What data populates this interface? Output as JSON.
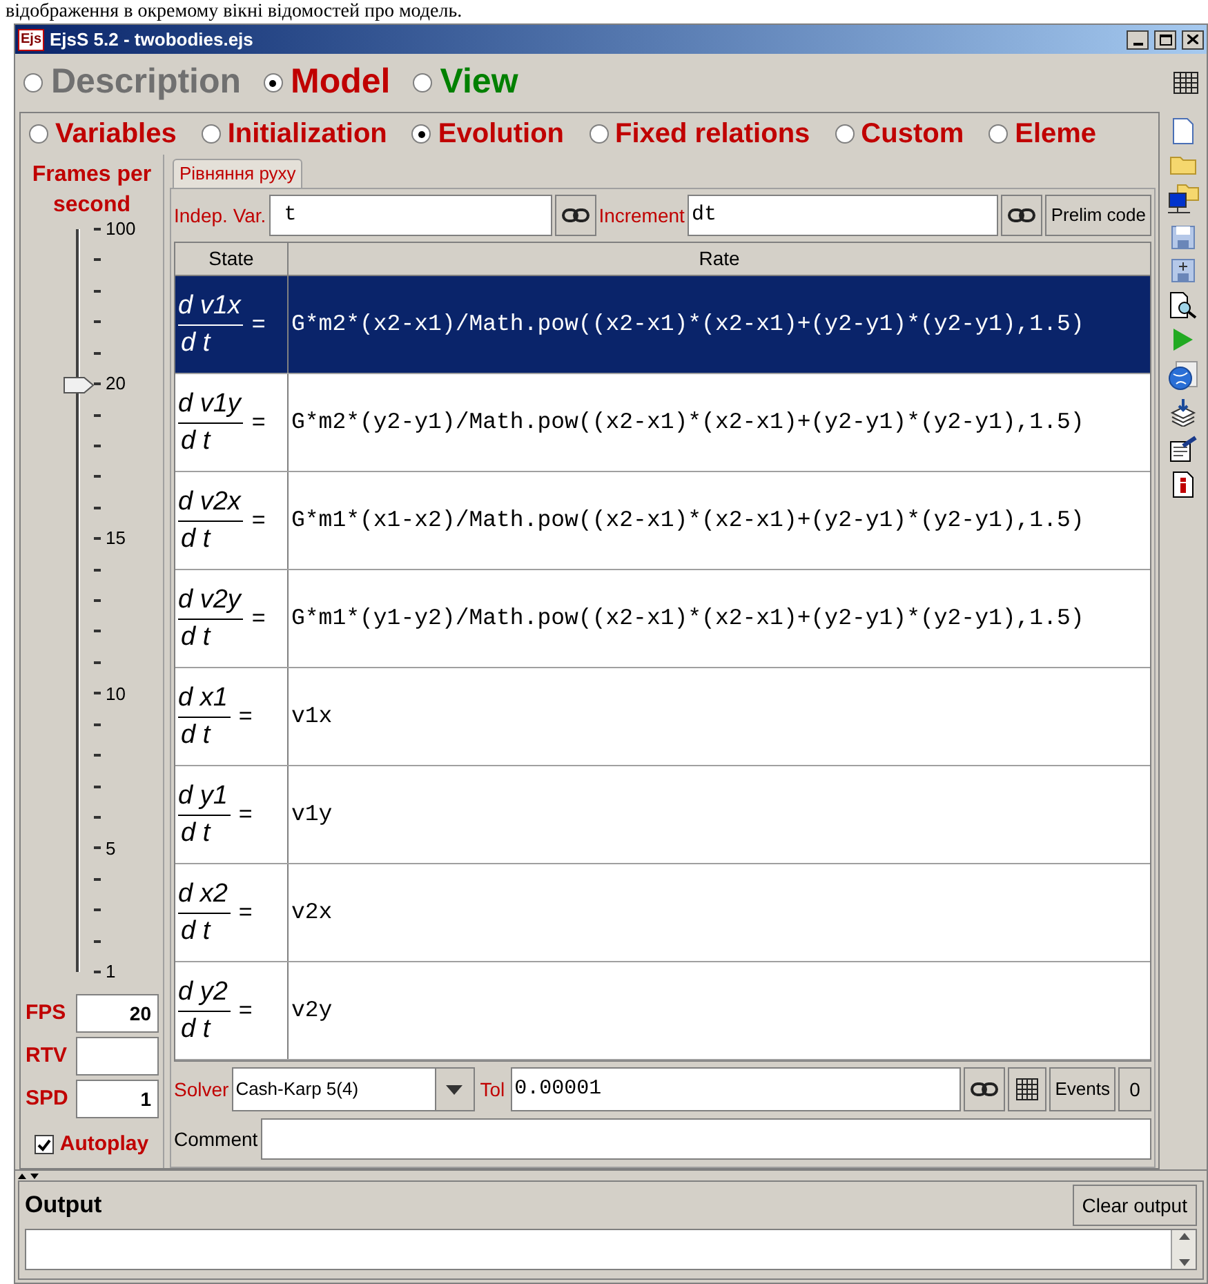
{
  "document_text": "відображення в окремому вікні відомостей про модель.",
  "window": {
    "logo": "Ejs",
    "title": "EjsS 5.2 - twobodies.ejs"
  },
  "main_tabs": [
    {
      "label": "Description",
      "selected": false,
      "color": "#707070"
    },
    {
      "label": "Model",
      "selected": true,
      "color": "#c00000"
    },
    {
      "label": "View",
      "selected": false,
      "color": "#008000"
    }
  ],
  "sub_tabs": [
    {
      "label": "Variables",
      "selected": false
    },
    {
      "label": "Initialization",
      "selected": false
    },
    {
      "label": "Evolution",
      "selected": true
    },
    {
      "label": "Fixed relations",
      "selected": false
    },
    {
      "label": "Custom",
      "selected": false
    },
    {
      "label": "Eleme",
      "selected": false
    }
  ],
  "frames_panel": {
    "title": "Frames per second",
    "slider": {
      "level": 0.79,
      "ticks": [
        {
          "kind": "major",
          "label": "100"
        },
        {
          "kind": "minor"
        },
        {
          "kind": "minor"
        },
        {
          "kind": "minor"
        },
        {
          "kind": "minor"
        },
        {
          "kind": "major",
          "label": "20"
        },
        {
          "kind": "minor"
        },
        {
          "kind": "minor"
        },
        {
          "kind": "minor"
        },
        {
          "kind": "minor"
        },
        {
          "kind": "major",
          "label": "15"
        },
        {
          "kind": "minor"
        },
        {
          "kind": "minor"
        },
        {
          "kind": "minor"
        },
        {
          "kind": "minor"
        },
        {
          "kind": "major",
          "label": "10"
        },
        {
          "kind": "minor"
        },
        {
          "kind": "minor"
        },
        {
          "kind": "minor"
        },
        {
          "kind": "minor"
        },
        {
          "kind": "major",
          "label": "5"
        },
        {
          "kind": "minor"
        },
        {
          "kind": "minor"
        },
        {
          "kind": "minor"
        },
        {
          "kind": "major",
          "label": "1"
        }
      ]
    },
    "fields": [
      {
        "label": "FPS",
        "value": "20"
      },
      {
        "label": "RTV"
      },
      {
        "label": "SPD",
        "value": "1"
      }
    ],
    "autoplay": {
      "label": "Autoplay",
      "checked": true
    }
  },
  "page_tab": {
    "label": "Рівняння руху"
  },
  "indep_var": {
    "label": "Indep. Var.",
    "value": "t"
  },
  "increment": {
    "label": "Increment",
    "value": "dt"
  },
  "prelim_button": "Prelim code",
  "table": {
    "columns": [
      "State",
      "Rate"
    ],
    "rows": [
      {
        "numerator": "d v1x",
        "denominator": "d t",
        "equals": "=",
        "rate": "G*m2*(x2-x1)/Math.pow((x2-x1)*(x2-x1)+(y2-y1)*(y2-y1),1.5)",
        "selected": true
      },
      {
        "numerator": "d v1y",
        "denominator": "d t",
        "equals": "=",
        "rate": "G*m2*(y2-y1)/Math.pow((x2-x1)*(x2-x1)+(y2-y1)*(y2-y1),1.5)",
        "selected": false
      },
      {
        "numerator": "d v2x",
        "denominator": "d t",
        "equals": "=",
        "rate": "G*m1*(x1-x2)/Math.pow((x2-x1)*(x2-x1)+(y2-y1)*(y2-y1),1.5)",
        "selected": false
      },
      {
        "numerator": "d v2y",
        "denominator": "d t",
        "equals": "=",
        "rate": "G*m1*(y1-y2)/Math.pow((x2-x1)*(x2-x1)+(y2-y1)*(y2-y1),1.5)",
        "selected": false
      },
      {
        "numerator": "d x1",
        "denominator": "d t",
        "equals": "=",
        "rate": "v1x",
        "selected": false
      },
      {
        "numerator": "d y1",
        "denominator": "d t",
        "equals": "=",
        "rate": "v1y",
        "selected": false
      },
      {
        "numerator": "d x2",
        "denominator": "d t",
        "equals": "=",
        "rate": "v2x",
        "selected": false
      },
      {
        "numerator": "d y2",
        "denominator": "d t",
        "equals": "=",
        "rate": "v2y",
        "selected": false
      }
    ]
  },
  "solver": {
    "label": "Solver",
    "value": "Cash-Karp 5(4)",
    "tol_label": "Tol",
    "tol_value": "0.00001",
    "events_button": "Events",
    "events_count": "0"
  },
  "comment": {
    "label": "Comment"
  },
  "output": {
    "title": "Output",
    "clear_button": "Clear output"
  }
}
